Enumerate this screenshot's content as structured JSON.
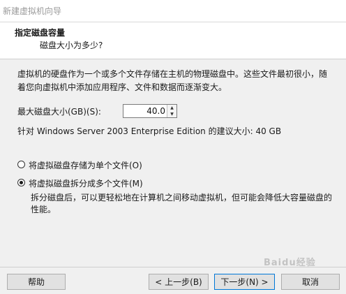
{
  "window": {
    "title": "新建虚拟机向导"
  },
  "header": {
    "title": "指定磁盘容量",
    "subtitle": "磁盘大小为多少?"
  },
  "description": "虚拟机的硬盘作为一个或多个文件存储在主机的物理磁盘中。这些文件最初很小，随着您向虚拟机中添加应用程序、文件和数据而逐渐变大。",
  "disk_size": {
    "label": "最大磁盘大小(GB)(S):",
    "value": "40.0"
  },
  "recommendation": "针对 Windows Server 2003 Enterprise Edition 的建议大小: 40 GB",
  "options": [
    {
      "label": "将虚拟磁盘存储为单个文件(O)",
      "selected": false
    },
    {
      "label": "将虚拟磁盘拆分成多个文件(M)",
      "selected": true
    }
  ],
  "split_description": "拆分磁盘后，可以更轻松地在计算机之间移动虚拟机，但可能会降低大容量磁盘的性能。",
  "buttons": {
    "help": "帮助",
    "back": "< 上一步(B)",
    "next": "下一步(N) >",
    "cancel": "取消"
  },
  "watermark": "Baidu经验"
}
